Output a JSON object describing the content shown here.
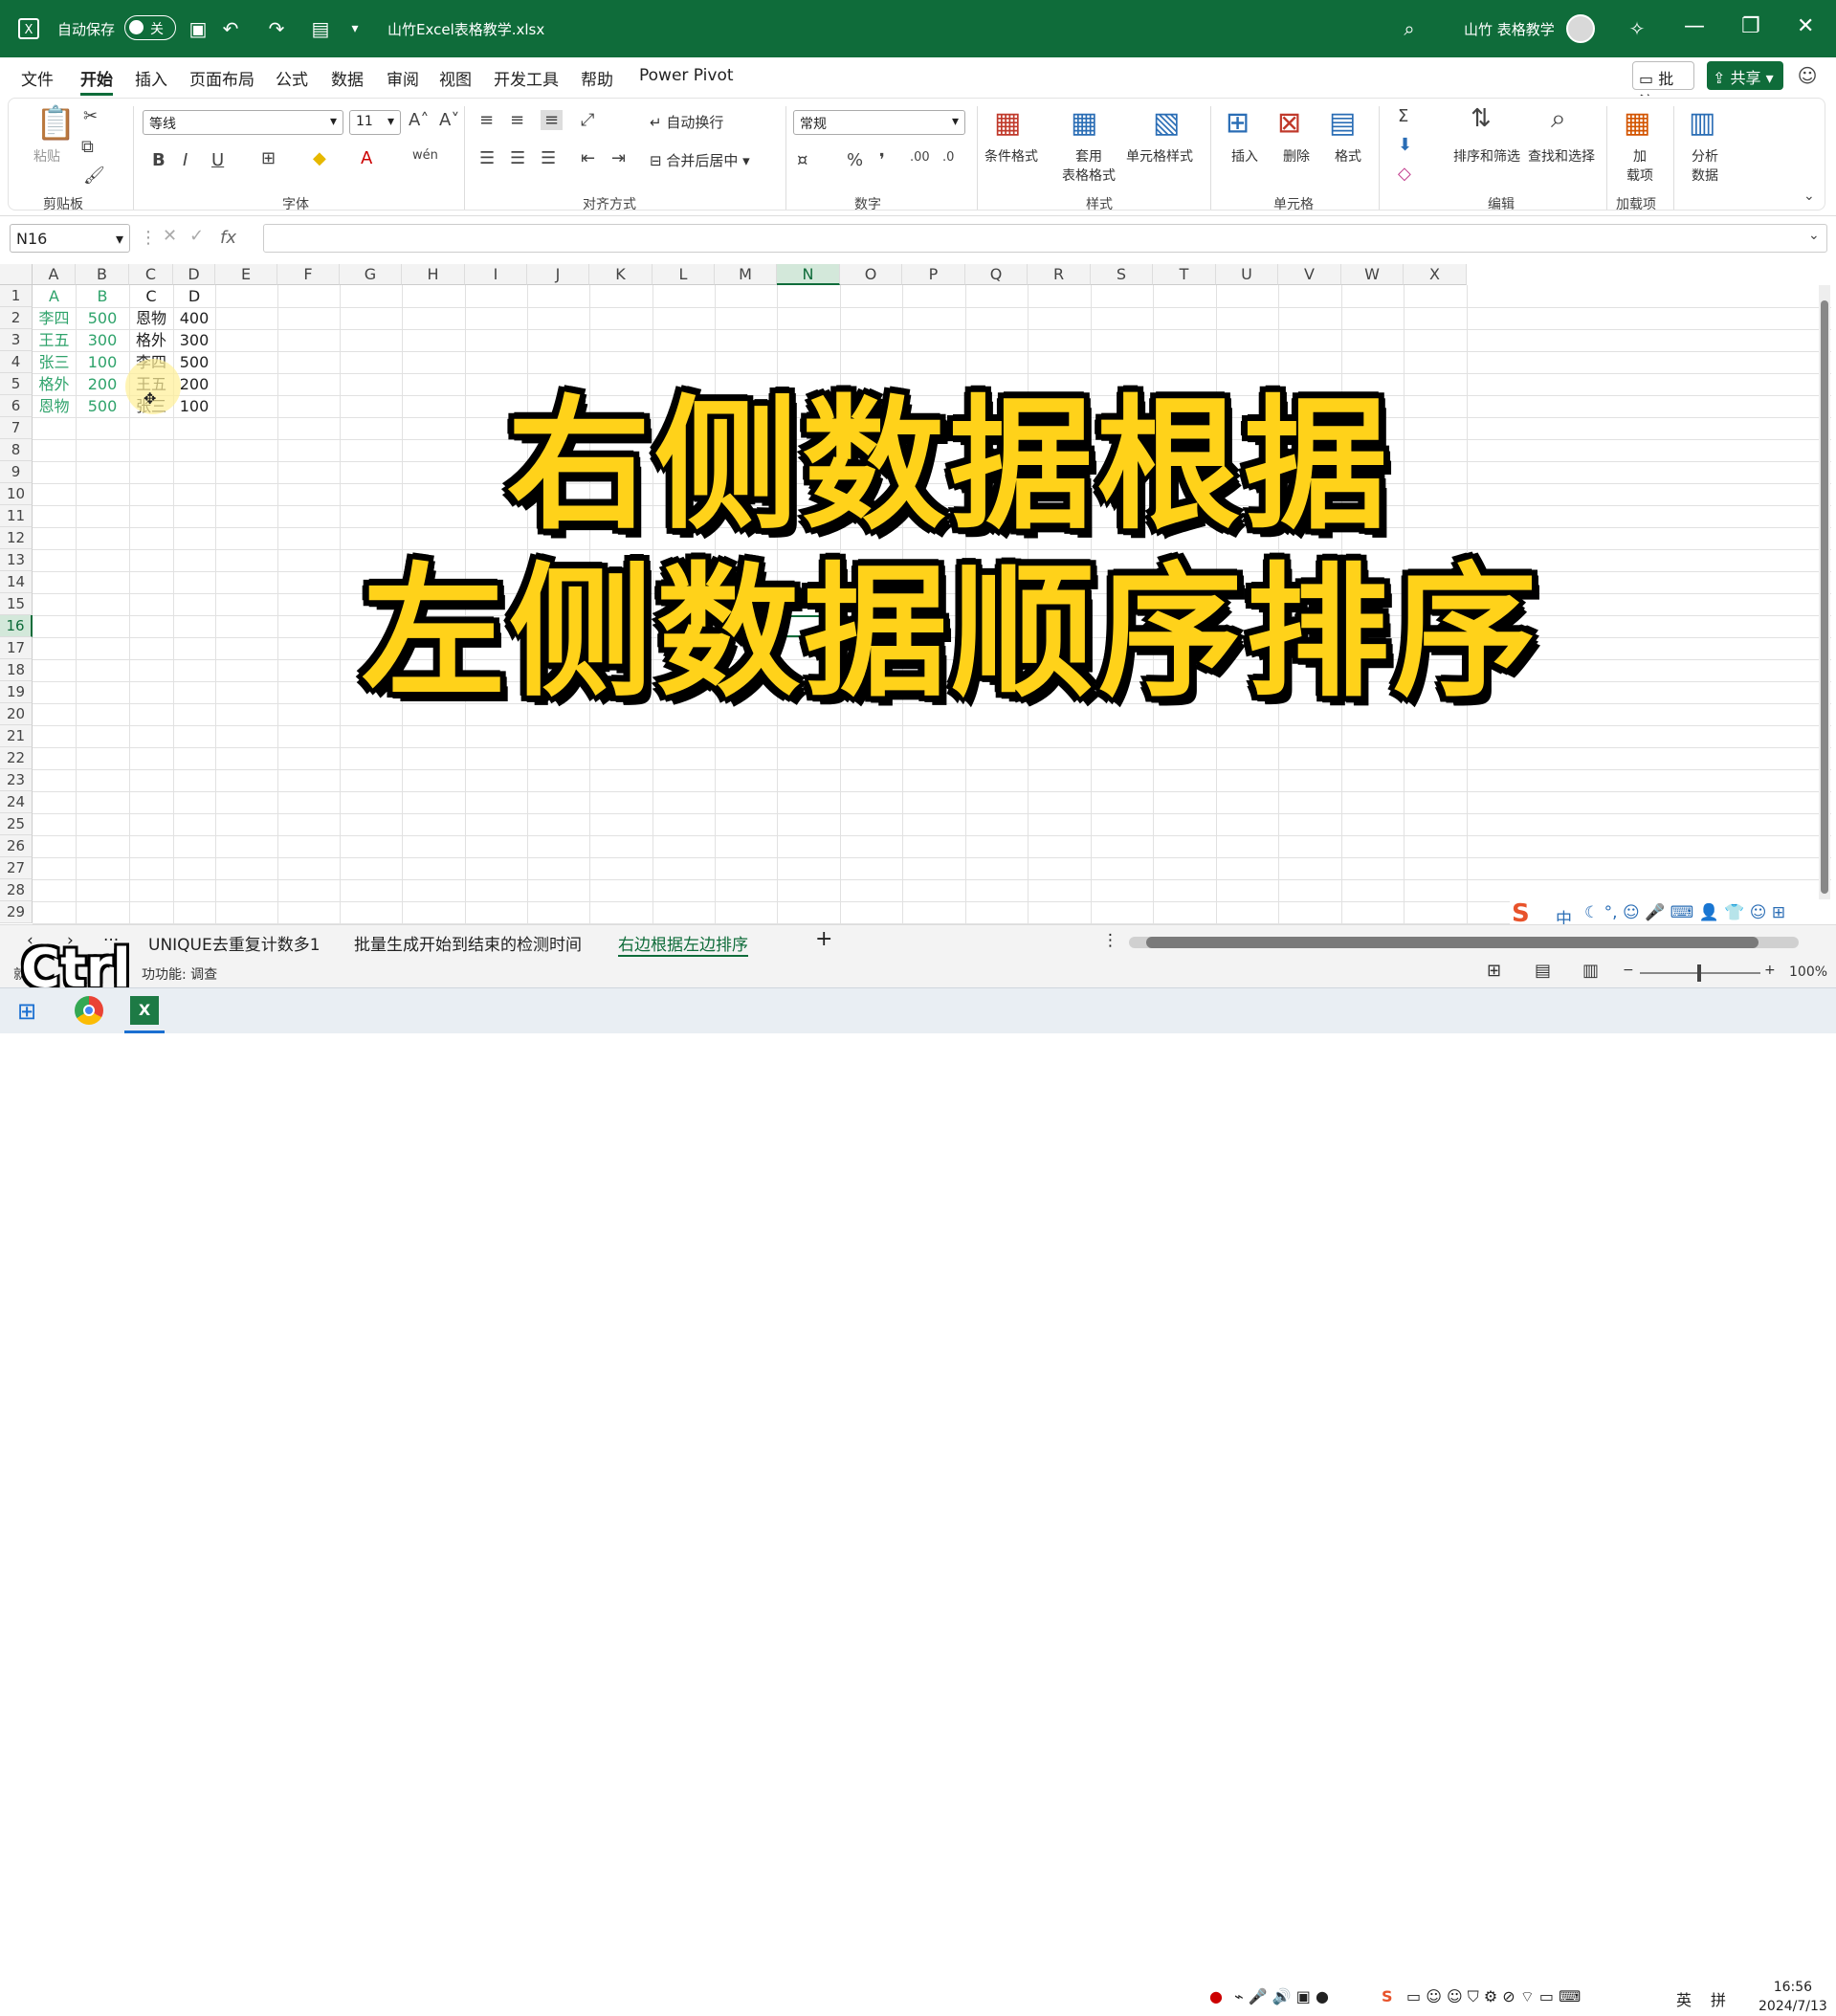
{
  "titlebar": {
    "autosave_label": "自动保存",
    "autosave_state": "关",
    "filename": "山竹Excel表格教学.xlsx",
    "user_name": "山竹 表格教学"
  },
  "menu": [
    "文件",
    "开始",
    "插入",
    "页面布局",
    "公式",
    "数据",
    "审阅",
    "视图",
    "开发工具",
    "帮助",
    "Power Pivot"
  ],
  "menu_active": "开始",
  "comment_label": "批注",
  "share_label": "共享",
  "ribbon": {
    "paste": "粘贴",
    "clipboard_group": "剪贴板",
    "font_name": "等线",
    "font_size": "11",
    "font_group": "字体",
    "wrap_text": "自动换行",
    "merge_center": "合并后居中",
    "align_group": "对齐方式",
    "number_format": "常规",
    "number_group": "数字",
    "conditional_format": "条件格式",
    "table_format": "套用\n表格格式",
    "cell_style": "单元格样式",
    "styles_group": "样式",
    "insert": "插入",
    "delete": "删除",
    "format": "格式",
    "cells_group": "单元格",
    "sort_filter": "排序和筛选",
    "find_select": "查找和选择",
    "edit_group": "编辑",
    "addins": "加\n载项",
    "addins_group": "加载项",
    "analyze": "分析\n数据"
  },
  "formula_bar": {
    "name_box": "N16",
    "fx": "fx"
  },
  "columns": [
    "A",
    "B",
    "C",
    "D",
    "E",
    "F",
    "G",
    "H",
    "I",
    "J",
    "K",
    "L",
    "M",
    "N",
    "O",
    "P",
    "Q",
    "R",
    "S",
    "T",
    "U",
    "V",
    "W",
    "X"
  ],
  "selected_column": "N",
  "selected_row": "16",
  "rows": [
    "1",
    "2",
    "3",
    "4",
    "5",
    "6",
    "7",
    "8",
    "9",
    "10",
    "11",
    "12",
    "13",
    "14",
    "15",
    "16",
    "17",
    "18",
    "19",
    "20",
    "21",
    "22",
    "23",
    "24",
    "25",
    "26",
    "27",
    "28",
    "29"
  ],
  "cells": {
    "A": [
      "A",
      "李四",
      "王五",
      "张三",
      "格外",
      "恩物"
    ],
    "B": [
      "B",
      "500",
      "300",
      "100",
      "200",
      "500"
    ],
    "C": [
      "C",
      "恩物",
      "格外",
      "李四",
      "王五",
      "张三"
    ],
    "D": [
      "D",
      "400",
      "300",
      "500",
      "200",
      "100"
    ]
  },
  "overlay": {
    "line1": "右侧数据根据",
    "line2": "左侧数据顺序排序"
  },
  "sheet_tabs": [
    "UNIQUE去重复计数多1",
    "批量生成开始到结束的检测时间",
    "右边根据左边排序"
  ],
  "active_tab": "右边根据左边排序",
  "status": {
    "left": "就",
    "accessibility": "功功能: 调查",
    "zoom": "100%"
  },
  "ctrl_overlay": "Ctrl",
  "taskbar": {
    "time": "16:56",
    "date": "2024/7/13",
    "ime1": "英",
    "ime2": "拼"
  },
  "ime_bar": "中",
  "colors": {
    "excel_green": "#0f6c3a",
    "data_green": "#2fa36b",
    "overlay_yellow": "#ffd21a"
  }
}
